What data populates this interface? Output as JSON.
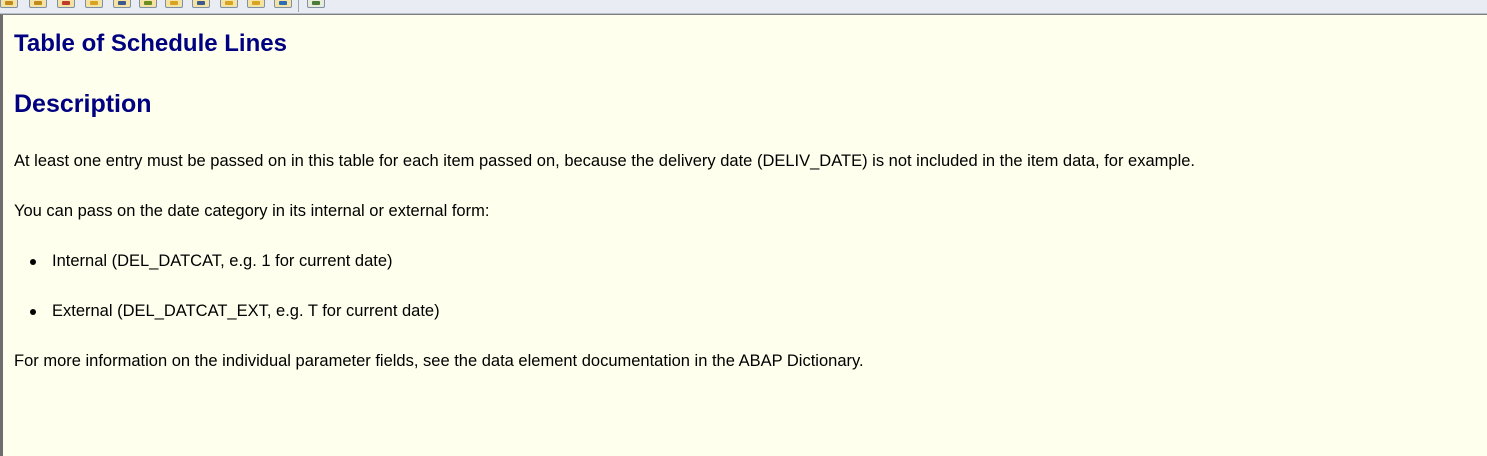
{
  "toolbar": {
    "buttons": [
      {
        "icon": "arrow-left-icon",
        "color": "#c28a1a"
      },
      {
        "icon": "arrow-right-icon",
        "color": "#c28a1a"
      },
      {
        "icon": "find-icon",
        "color": "#c0392b"
      },
      {
        "icon": "bookmark-icon",
        "color": "#d9a520"
      },
      {
        "icon": "print-icon",
        "color": "#3d5a8a"
      },
      {
        "icon": "pencil-icon",
        "color": "#6b8e23"
      },
      {
        "icon": "info-icon",
        "color": "#d9a520"
      },
      {
        "icon": "document-icon",
        "color": "#3d5a8a"
      },
      {
        "icon": "folder-icon",
        "color": "#d9a520"
      },
      {
        "icon": "help-icon",
        "color": "#d9a520"
      },
      {
        "icon": "settings-icon",
        "color": "#2e6db4"
      },
      {
        "icon": "window-icon",
        "color": "#4a7b3a"
      }
    ]
  },
  "document": {
    "title": "Table of Schedule Lines",
    "section_heading": "Description",
    "paragraphs": [
      "At least one entry must be passed on in this table for each item passed on, because the delivery date (DELIV_DATE) is not included in the item data, for example.",
      "You can pass on the date category in its internal or external form:",
      "For more information on the individual parameter fields, see the data element documentation in the ABAP Dictionary."
    ],
    "bullets": [
      "Internal (DEL_DATCAT, e.g. 1 for current date)",
      "External (DEL_DATCAT_EXT, e.g. T for current date)"
    ]
  },
  "colors": {
    "heading": "#000080",
    "background": "#ffffed"
  }
}
